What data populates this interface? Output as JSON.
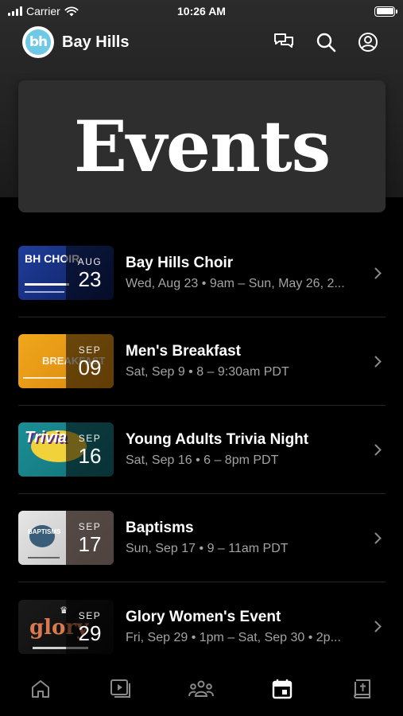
{
  "status_bar": {
    "carrier": "Carrier",
    "time": "10:26 AM"
  },
  "header": {
    "logo_text": "bh",
    "app_name": "Bay Hills",
    "icons": [
      "chat-icon",
      "search-icon",
      "profile-icon"
    ]
  },
  "banner": {
    "title": "Events"
  },
  "events": [
    {
      "title": "Bay Hills Choir",
      "subtitle": "Wed, Aug 23 • 9am – Sun, May 26, 2...",
      "month": "AUG",
      "day": "23",
      "thumb_text": "BH CHOIR",
      "thumb_colors": [
        "#1f3e9c",
        "#0d1d5a"
      ]
    },
    {
      "title": "Men's Breakfast",
      "subtitle": "Sat, Sep 9 • 8 – 9:30am PDT",
      "month": "SEP",
      "day": "09",
      "thumb_text": "BREAKFAST",
      "thumb_colors": [
        "#f0a71c",
        "#d8860d"
      ]
    },
    {
      "title": "Young Adults Trivia Night",
      "subtitle": "Sat, Sep 16 • 6 – 8pm PDT",
      "month": "SEP",
      "day": "16",
      "thumb_text": "Trivia",
      "thumb_colors": [
        "#1b8e95",
        "#127078"
      ]
    },
    {
      "title": "Baptisms",
      "subtitle": "Sun, Sep 17 • 9 – 11am PDT",
      "month": "SEP",
      "day": "17",
      "thumb_text": "BAPTISMS",
      "thumb_colors": [
        "#e6e6e6",
        "#bdbdbd"
      ]
    },
    {
      "title": "Glory Women's Event",
      "subtitle": "Fri, Sep 29 • 1pm – Sat, Sep 30 • 2p...",
      "month": "SEP",
      "day": "29",
      "thumb_text": "glory",
      "thumb_colors": [
        "#1a1a1a",
        "#0c0c0c"
      ]
    }
  ],
  "tab_bar": {
    "tabs": [
      "home-tab",
      "media-tab",
      "groups-tab",
      "events-tab",
      "bible-tab"
    ],
    "active": "events-tab",
    "active_color": "#ffffff",
    "inactive_color": "#8a8a8a"
  }
}
